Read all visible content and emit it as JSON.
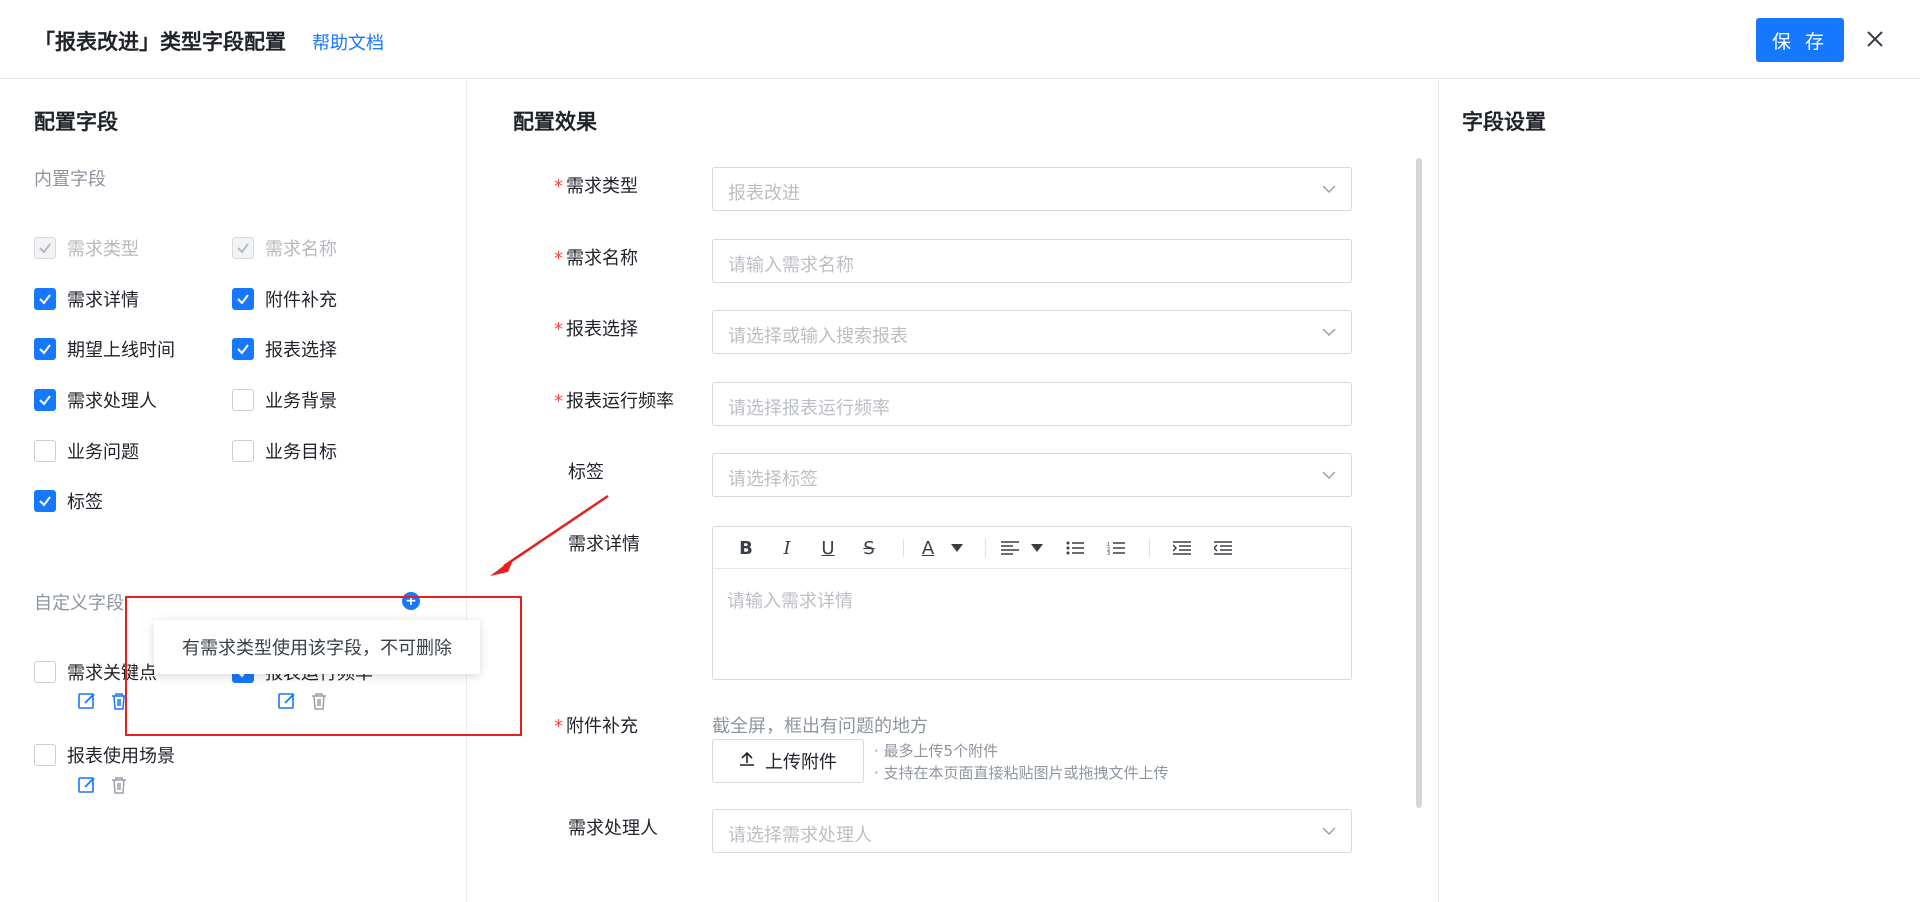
{
  "header": {
    "title": "「报表改进」类型字段配置",
    "help_link": "帮助文档",
    "save_label": "保 存"
  },
  "left": {
    "title": "配置字段",
    "builtin_label": "内置字段",
    "builtin_fields": [
      {
        "label": "需求类型",
        "state": "checked-disabled"
      },
      {
        "label": "需求名称",
        "state": "checked-disabled"
      },
      {
        "label": "需求详情",
        "state": "checked"
      },
      {
        "label": "附件补充",
        "state": "checked"
      },
      {
        "label": "期望上线时间",
        "state": "checked"
      },
      {
        "label": "报表选择",
        "state": "checked"
      },
      {
        "label": "需求处理人",
        "state": "checked"
      },
      {
        "label": "业务背景",
        "state": "unchecked"
      },
      {
        "label": "业务问题",
        "state": "unchecked"
      },
      {
        "label": "业务目标",
        "state": "unchecked"
      },
      {
        "label": "标签",
        "state": "checked"
      }
    ],
    "custom_label": "自定义字段",
    "custom_fields": [
      {
        "label": "需求关键点",
        "state": "unchecked"
      },
      {
        "label": "报表运行频率",
        "state": "checked"
      },
      {
        "label": "报表使用场景",
        "state": "unchecked"
      }
    ],
    "tooltip": "有需求类型使用该字段，不可删除"
  },
  "middle": {
    "title": "配置效果",
    "rows": [
      {
        "label": "需求类型",
        "required": true,
        "placeholder": "报表改进",
        "dropdown": true
      },
      {
        "label": "需求名称",
        "required": true,
        "placeholder": "请输入需求名称",
        "dropdown": false
      },
      {
        "label": "报表选择",
        "required": true,
        "placeholder": "请选择或输入搜索报表",
        "dropdown": true
      },
      {
        "label": "报表运行频率",
        "required": true,
        "placeholder": "请选择报表运行频率",
        "dropdown": false
      },
      {
        "label": "标签",
        "required": false,
        "placeholder": "请选择标签",
        "dropdown": true
      }
    ],
    "detail": {
      "label": "需求详情",
      "placeholder": "请输入需求详情"
    },
    "attachment": {
      "label": "附件补充",
      "tip": "截全屏，框出有问题的地方",
      "button": "上传附件",
      "note1": "· 最多上传5个附件",
      "note2": "· 支持在本页面直接粘贴图片或拖拽文件上传"
    },
    "handler": {
      "label": "需求处理人",
      "placeholder": "请选择需求处理人"
    }
  },
  "right": {
    "title": "字段设置"
  },
  "colors": {
    "primary": "#1677ff",
    "required": "#f54a45",
    "annotation": "#e5211d"
  }
}
